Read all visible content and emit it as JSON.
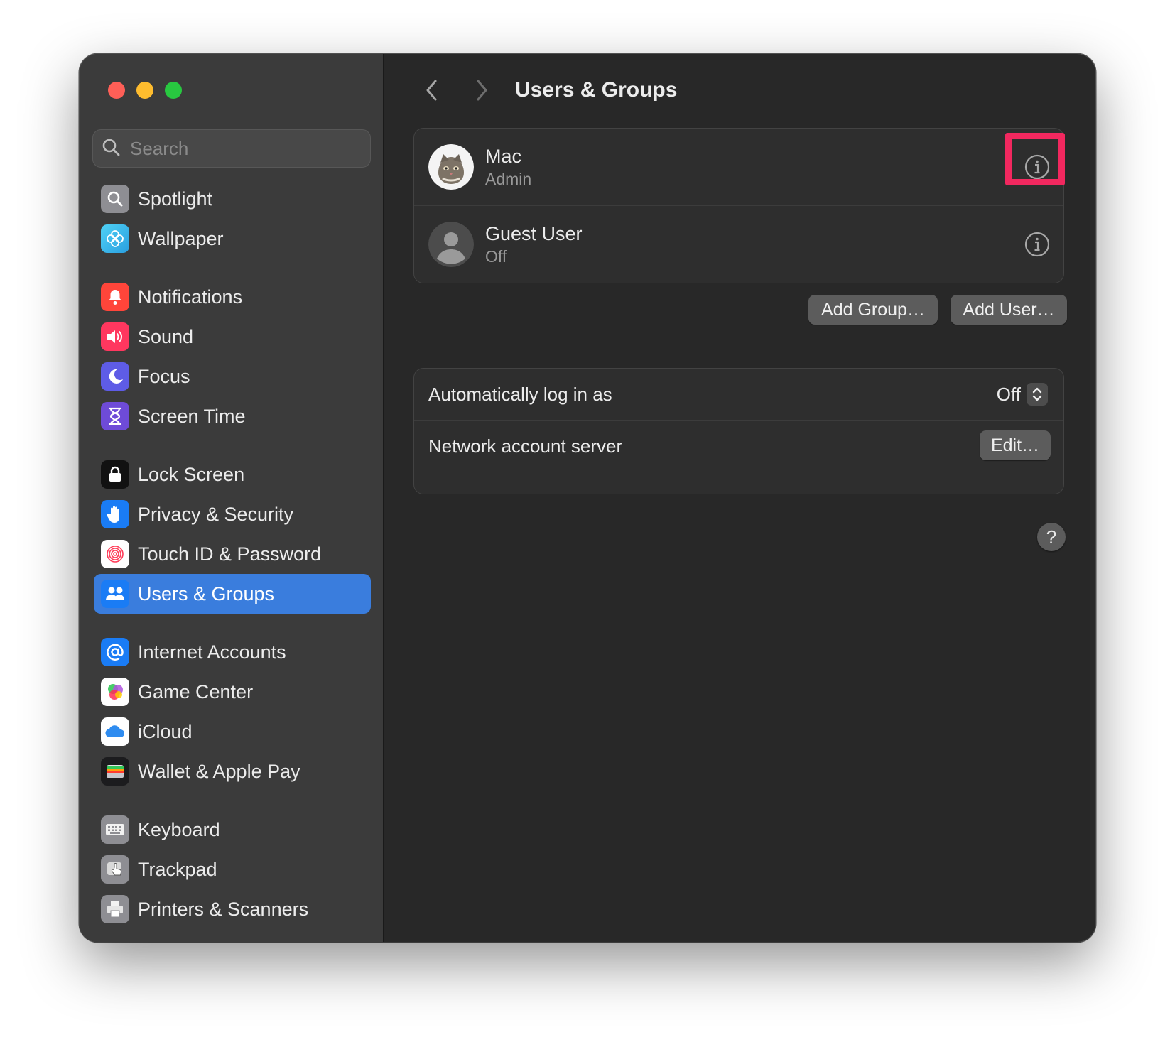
{
  "window": {
    "title": "Users & Groups"
  },
  "sidebar": {
    "search_placeholder": "Search",
    "items": [
      {
        "label": "Spotlight",
        "icon": "spotlight-icon",
        "color": "#8e8e93"
      },
      {
        "label": "Wallpaper",
        "icon": "wallpaper-icon",
        "color": "#35c3e8"
      },
      {
        "label": "Notifications",
        "icon": "notifications-icon",
        "color": "#ff3b30"
      },
      {
        "label": "Sound",
        "icon": "sound-icon",
        "color": "#ff2d55"
      },
      {
        "label": "Focus",
        "icon": "focus-icon",
        "color": "#5e5ce6"
      },
      {
        "label": "Screen Time",
        "icon": "screen-time-icon",
        "color": "#6e4bd8"
      },
      {
        "label": "Lock Screen",
        "icon": "lock-screen-icon",
        "color": "#111111"
      },
      {
        "label": "Privacy & Security",
        "icon": "privacy-hand-icon",
        "color": "#1a7cf5"
      },
      {
        "label": "Touch ID & Password",
        "icon": "fingerprint-icon",
        "color": "#ffffff"
      },
      {
        "label": "Users & Groups",
        "icon": "users-icon",
        "color": "#1a7cf5",
        "selected": true
      },
      {
        "label": "Internet Accounts",
        "icon": "at-sign-icon",
        "color": "#1a7cf5"
      },
      {
        "label": "Game Center",
        "icon": "game-center-icon",
        "color": "#ffffff"
      },
      {
        "label": "iCloud",
        "icon": "icloud-icon",
        "color": "#ffffff"
      },
      {
        "label": "Wallet & Apple Pay",
        "icon": "wallet-icon",
        "color": "#1c1c1e"
      },
      {
        "label": "Keyboard",
        "icon": "keyboard-icon",
        "color": "#8e8e93"
      },
      {
        "label": "Trackpad",
        "icon": "trackpad-icon",
        "color": "#8e8e93"
      },
      {
        "label": "Printers & Scanners",
        "icon": "printer-icon",
        "color": "#8e8e93"
      }
    ]
  },
  "header": {
    "title": "Users & Groups"
  },
  "users": [
    {
      "name": "Mac",
      "role": "Admin"
    },
    {
      "name": "Guest User",
      "role": "Off"
    }
  ],
  "buttons": {
    "add_group": "Add Group…",
    "add_user": "Add User…",
    "edit": "Edit…",
    "help": "?"
  },
  "settings": {
    "auto_login_label": "Automatically log in as",
    "auto_login_value": "Off",
    "network_server_label": "Network account server"
  },
  "colors": {
    "accent": "#3a7ddd",
    "highlight": "#f2285f"
  }
}
